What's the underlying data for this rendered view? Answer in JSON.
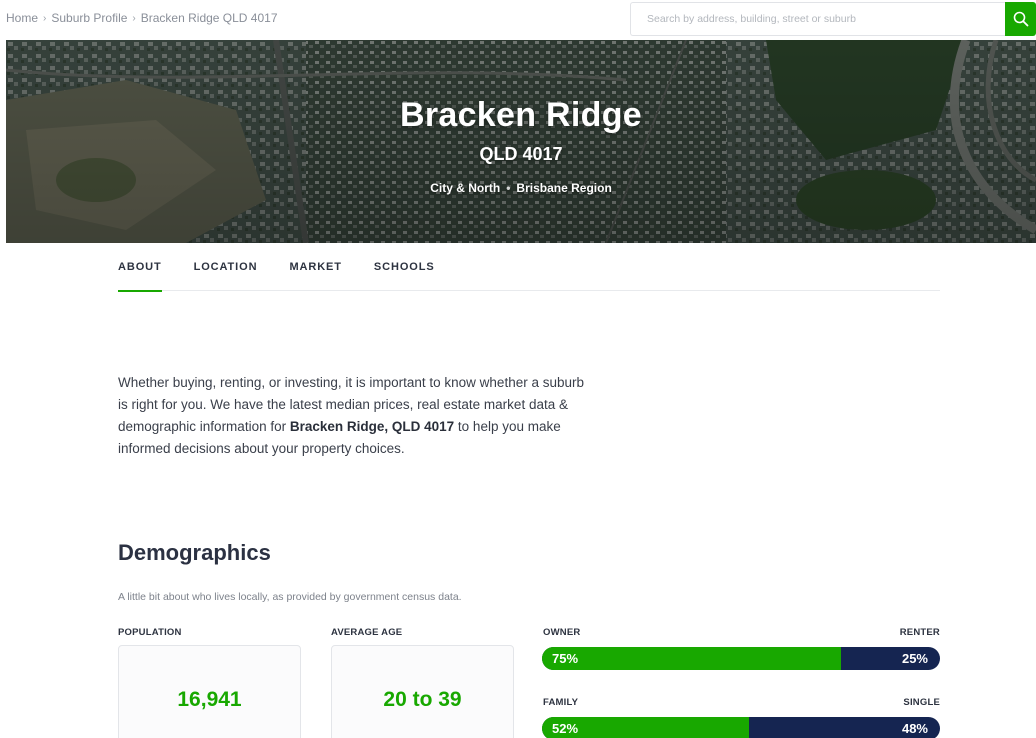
{
  "breadcrumb": {
    "items": [
      "Home",
      "Suburb Profile",
      "Bracken Ridge QLD 4017"
    ],
    "separator": "›"
  },
  "search": {
    "placeholder": "Search by address, building, street or suburb",
    "value": "",
    "button_icon": "search-icon"
  },
  "hero": {
    "title": "Bracken Ridge",
    "state_postcode": "QLD 4017",
    "area": "City & North",
    "region": "Brisbane Region",
    "separator": "•"
  },
  "tabs": [
    {
      "label": "ABOUT",
      "active": true
    },
    {
      "label": "LOCATION",
      "active": false
    },
    {
      "label": "MARKET",
      "active": false
    },
    {
      "label": "SCHOOLS",
      "active": false
    }
  ],
  "intro": {
    "text_before": "Whether buying, renting, or investing, it is important to know whether a suburb is right for you. We have the latest median prices, real estate market data & demographic information for ",
    "highlight": "Bracken Ridge, QLD 4017",
    "text_after": " to help you make informed decisions about your property choices."
  },
  "demographics": {
    "title": "Demographics",
    "subtitle": "A little bit about who lives locally, as provided by government census data.",
    "population": {
      "label": "POPULATION",
      "value": "16,941"
    },
    "average_age": {
      "label": "AVERAGE AGE",
      "value": "20 to 39"
    },
    "owner_renter": {
      "left_label": "OWNER",
      "right_label": "RENTER",
      "left_value": "75%",
      "right_value": "25%",
      "left_fraction": 0.75
    },
    "family_single": {
      "left_label": "FAMILY",
      "right_label": "SINGLE",
      "left_value": "52%",
      "right_value": "48%",
      "left_fraction": 0.52
    }
  },
  "colors": {
    "accent": "#18a800",
    "navy": "#152551",
    "heading": "#2b3142"
  }
}
